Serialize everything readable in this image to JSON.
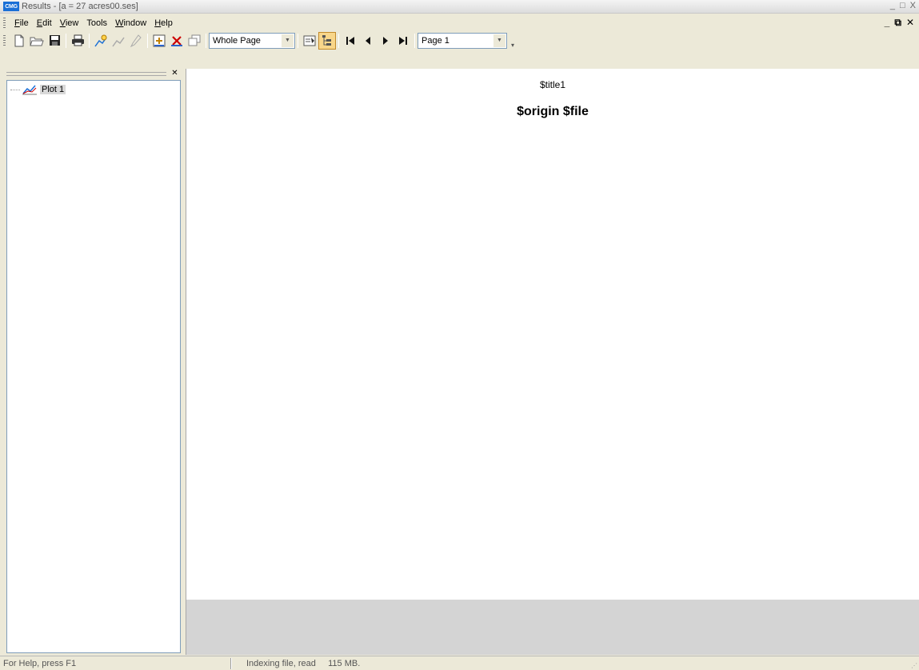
{
  "window": {
    "app_icon_text": "CMG",
    "title": "Results - [a = 27 acres00.ses]",
    "controls": [
      "_",
      "□",
      "X"
    ]
  },
  "menubar": {
    "items": [
      {
        "label": "File",
        "accel": "F"
      },
      {
        "label": "Edit",
        "accel": "E"
      },
      {
        "label": "View",
        "accel": "V"
      },
      {
        "label": "Tools",
        "accel": ""
      },
      {
        "label": "Window",
        "accel": "W"
      },
      {
        "label": "Help",
        "accel": "H"
      }
    ],
    "mdi_controls": [
      "_",
      "⧉",
      "✕"
    ]
  },
  "toolbar": {
    "zoom_combo_value": "Whole Page",
    "page_combo_value": "Page 1"
  },
  "tree": {
    "items": [
      {
        "label": "Plot 1"
      }
    ]
  },
  "plot": {
    "title1": "$title1",
    "title2": "$origin $file"
  },
  "statusbar": {
    "help_text": "For Help, press F1",
    "indexing_text": "Indexing file, read     115 MB."
  },
  "colors": {
    "chrome": "#ece9d8",
    "accent": "#1a6fd6",
    "view_bg": "#d4d4d4"
  }
}
